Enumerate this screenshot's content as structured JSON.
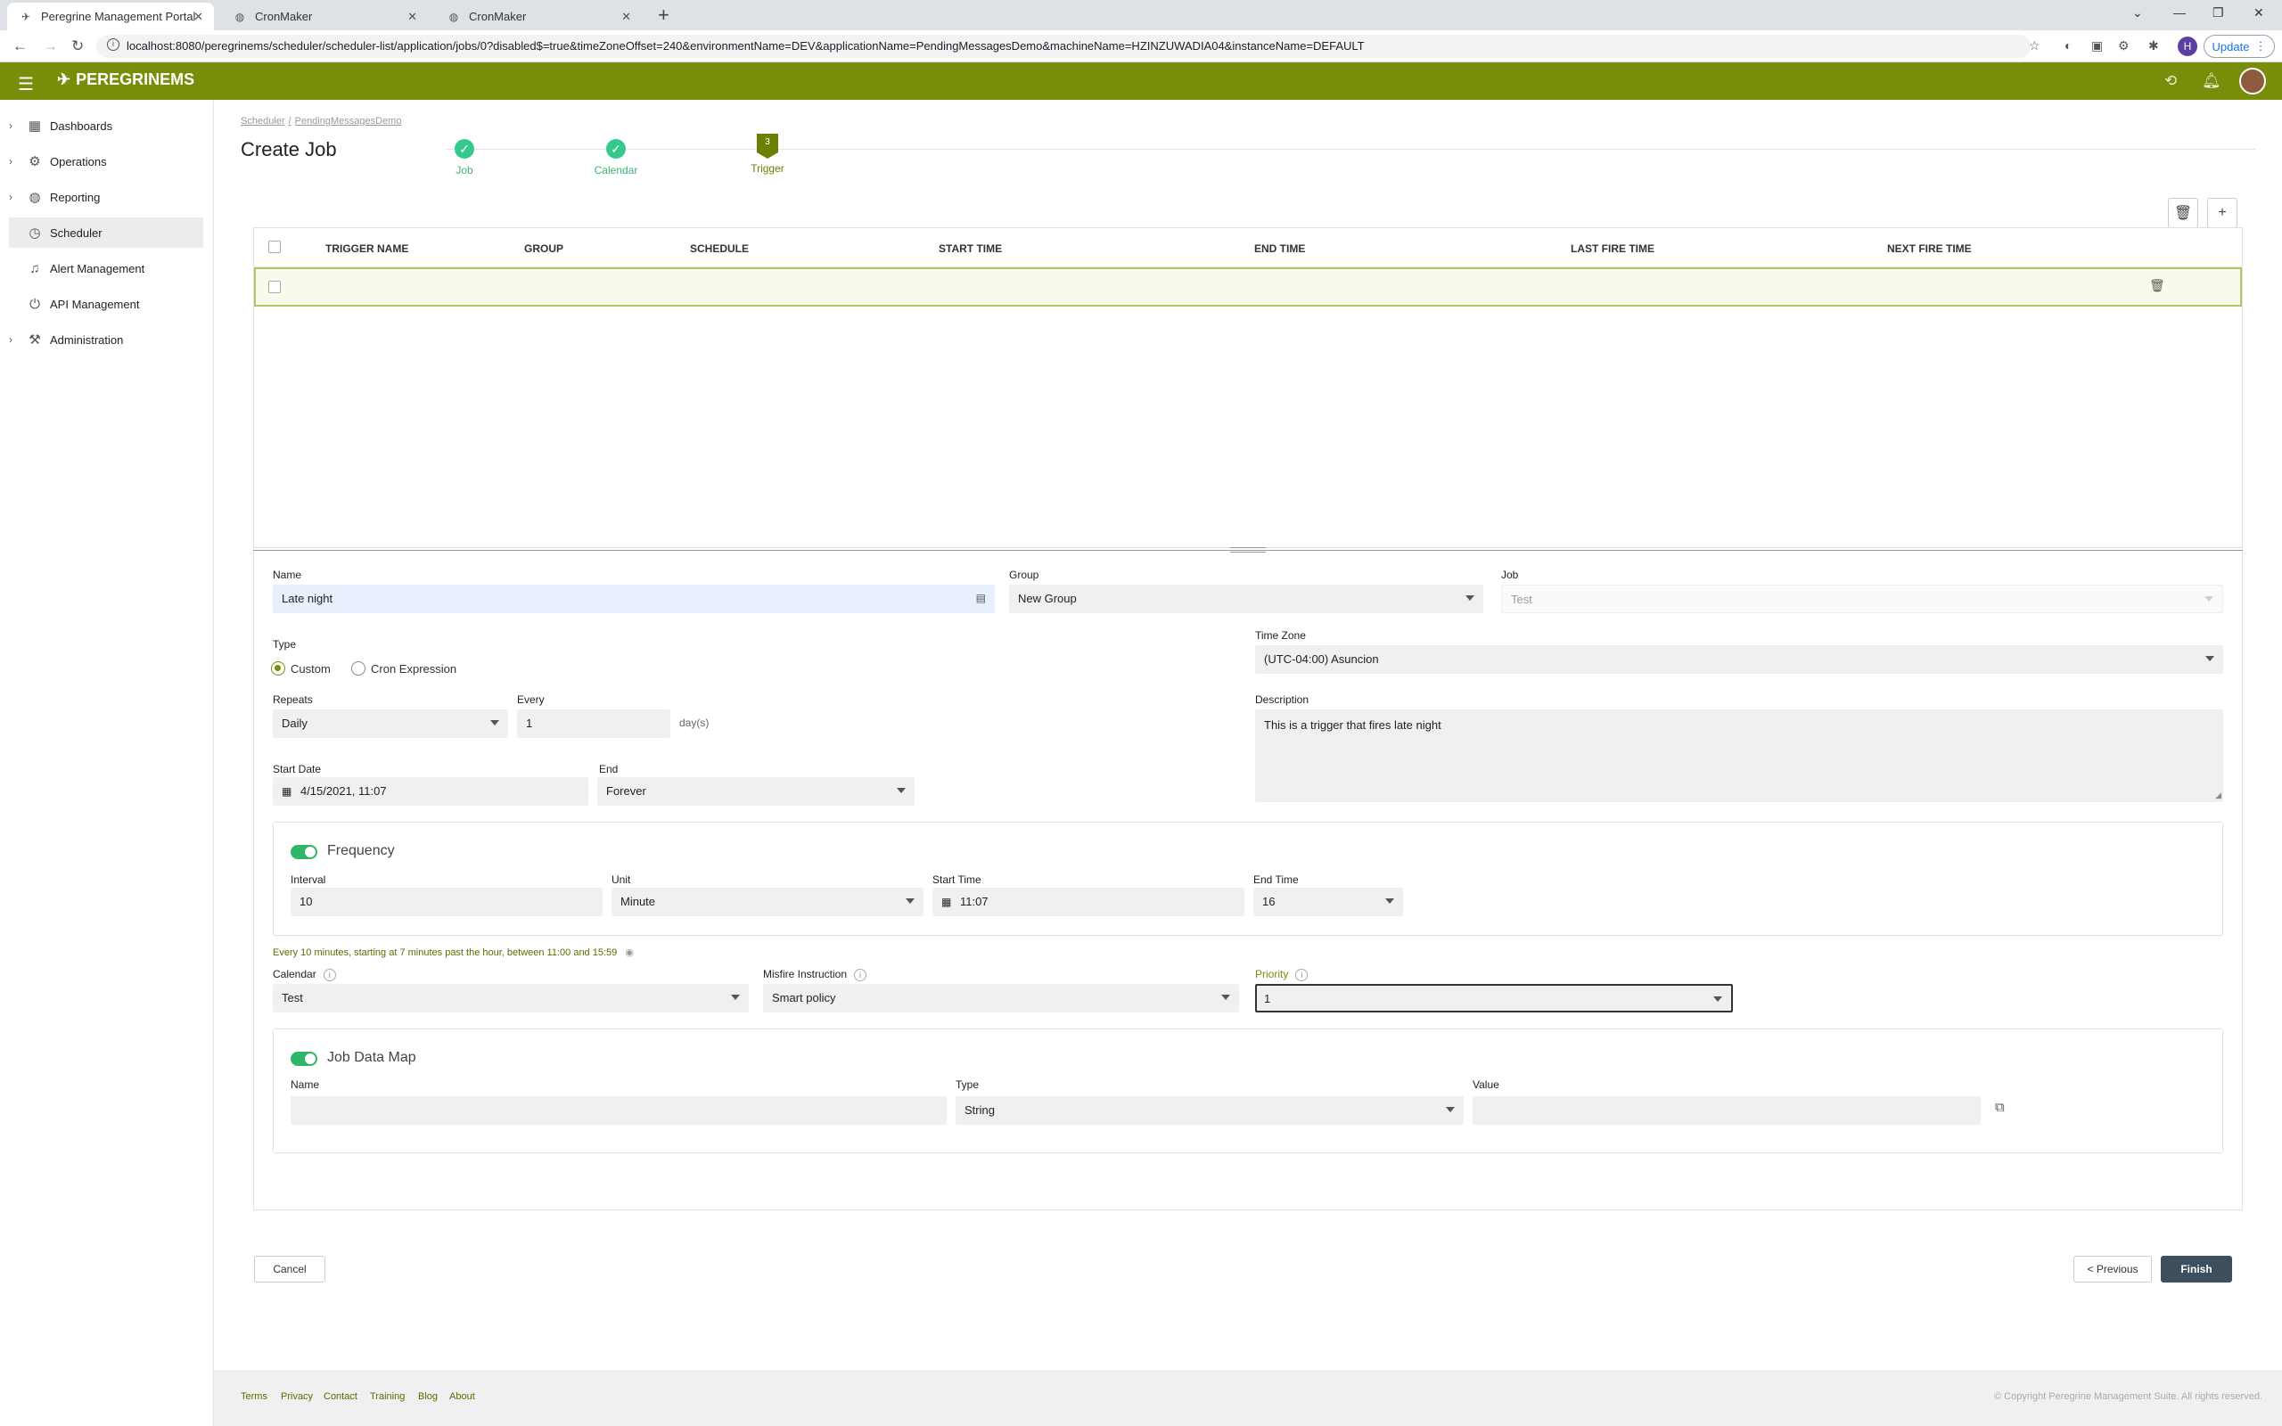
{
  "browser": {
    "tabs": [
      {
        "title": "Peregrine Management Portal"
      },
      {
        "title": "CronMaker"
      },
      {
        "title": "CronMaker"
      }
    ],
    "url": "localhost:8080/peregrinems/scheduler/scheduler-list/application/jobs/0?disabled$=true&timeZoneOffset=240&environmentName=DEV&applicationName=PendingMessagesDemo&machineName=HZINZUWADIA04&instanceName=DEFAULT",
    "profile_initial": "H",
    "update_label": "Update"
  },
  "app": {
    "logo_text": "PEREGRINEMS"
  },
  "sidebar": {
    "items": [
      {
        "label": "Dashboards",
        "icon": "dashboard-icon"
      },
      {
        "label": "Operations",
        "icon": "gear-icon"
      },
      {
        "label": "Reporting",
        "icon": "globe-icon"
      },
      {
        "label": "Scheduler",
        "icon": "clock-icon"
      },
      {
        "label": "Alert Management",
        "icon": "bell-icon"
      },
      {
        "label": "API Management",
        "icon": "plug-icon"
      },
      {
        "label": "Administration",
        "icon": "wrench-icon"
      }
    ]
  },
  "breadcrumb": {
    "root": "Scheduler",
    "separator": "/",
    "current": "PendingMessagesDemo"
  },
  "page": {
    "title": "Create Job"
  },
  "steps": [
    {
      "label": "Job",
      "badge": "✓"
    },
    {
      "label": "Calendar",
      "badge": "✓"
    },
    {
      "label": "Trigger",
      "badge": "3"
    }
  ],
  "grid": {
    "columns": [
      "TRIGGER NAME",
      "GROUP",
      "SCHEDULE",
      "START TIME",
      "END TIME",
      "LAST FIRE TIME",
      "NEXT FIRE TIME"
    ]
  },
  "form": {
    "name": {
      "label": "Name",
      "value": "Late night"
    },
    "group": {
      "label": "Group",
      "value": "New Group"
    },
    "job": {
      "label": "Job",
      "value": "Test"
    },
    "type": {
      "label": "Type",
      "options": [
        "Custom",
        "Cron Expression"
      ],
      "selected": "Custom"
    },
    "timezone": {
      "label": "Time Zone",
      "value": "(UTC-04:00) Asuncion"
    },
    "repeats": {
      "label": "Repeats",
      "value": "Daily"
    },
    "every": {
      "label": "Every",
      "value": "1",
      "unit": "day(s)"
    },
    "description": {
      "label": "Description",
      "value": "This is a trigger that fires late night"
    },
    "start_date": {
      "label": "Start Date",
      "value": "4/15/2021, 11:07"
    },
    "end": {
      "label": "End",
      "value": "Forever"
    },
    "frequency": {
      "title": "Frequency",
      "interval": {
        "label": "Interval",
        "value": "10"
      },
      "unit": {
        "label": "Unit",
        "value": "Minute"
      },
      "start_time": {
        "label": "Start Time",
        "value": "11:07"
      },
      "end_time": {
        "label": "End Time",
        "value": "16"
      }
    },
    "summary": "Every 10 minutes, starting at 7 minutes past the hour, between 11:00 and 15:59",
    "calendar": {
      "label": "Calendar",
      "value": "Test"
    },
    "misfire": {
      "label": "Misfire Instruction",
      "value": "Smart policy"
    },
    "priority": {
      "label": "Priority",
      "value": "1"
    },
    "job_data_map": {
      "title": "Job Data Map",
      "name_label": "Name",
      "type_label": "Type",
      "type_value": "String",
      "value_label": "Value"
    }
  },
  "actions": {
    "cancel": "Cancel",
    "previous": "< Previous",
    "finish": "Finish"
  },
  "footer": {
    "links": [
      "Terms",
      "Privacy",
      "Contact",
      "Training",
      "Blog",
      "About"
    ],
    "copyright": "© Copyright Peregrine Management Suite. All rights reserved."
  },
  "colors": {
    "brand": "#788e0b",
    "success": "#35c98c",
    "primary_button": "#3d4f5c"
  }
}
